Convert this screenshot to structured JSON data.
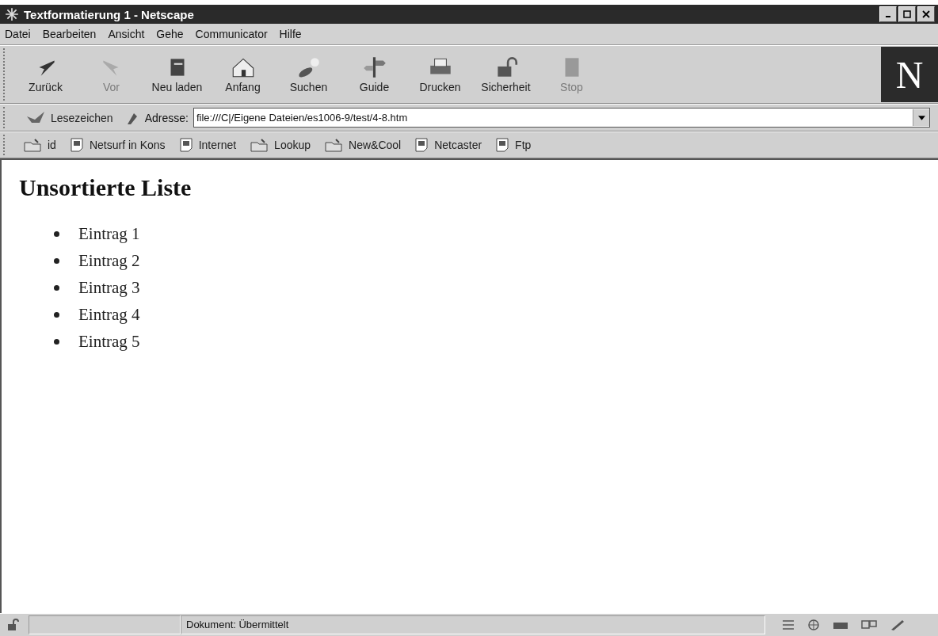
{
  "window": {
    "title": "Textformatierung 1 - Netscape"
  },
  "menu": [
    "Datei",
    "Bearbeiten",
    "Ansicht",
    "Gehe",
    "Communicator",
    "Hilfe"
  ],
  "toolbar": [
    {
      "label": "Zurück",
      "disabled": false
    },
    {
      "label": "Vor",
      "disabled": true
    },
    {
      "label": "Neu laden",
      "disabled": false
    },
    {
      "label": "Anfang",
      "disabled": false
    },
    {
      "label": "Suchen",
      "disabled": false
    },
    {
      "label": "Guide",
      "disabled": false
    },
    {
      "label": "Drucken",
      "disabled": false
    },
    {
      "label": "Sicherheit",
      "disabled": false
    },
    {
      "label": "Stop",
      "disabled": true
    }
  ],
  "logo": "N",
  "location_bar": {
    "bookmarks": "Lesezeichen",
    "address_label": "Adresse:",
    "address": "file:///C|/Eigene Dateien/es1006-9/test/4-8.htm"
  },
  "personal_toolbar": [
    {
      "label": "id",
      "kind": "folder"
    },
    {
      "label": "Netsurf in Kons",
      "kind": "page"
    },
    {
      "label": "Internet",
      "kind": "page"
    },
    {
      "label": "Lookup",
      "kind": "folder"
    },
    {
      "label": "New&Cool",
      "kind": "folder"
    },
    {
      "label": "Netcaster",
      "kind": "page"
    },
    {
      "label": "Ftp",
      "kind": "page"
    }
  ],
  "content": {
    "heading": "Unsortierte Liste",
    "items": [
      "Eintrag 1",
      "Eintrag 2",
      "Eintrag 3",
      "Eintrag 4",
      "Eintrag 5"
    ]
  },
  "status_bar": {
    "text": "Dokument: Übermittelt"
  }
}
